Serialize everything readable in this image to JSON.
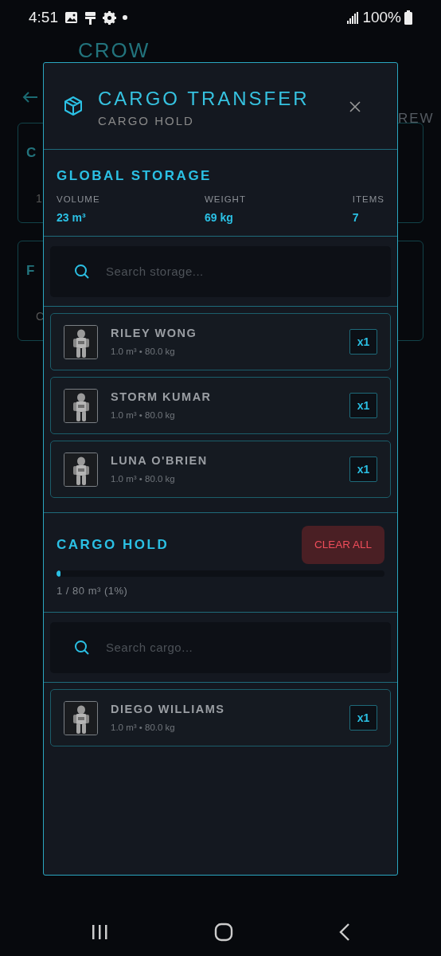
{
  "status_bar": {
    "time": "4:51",
    "battery": "100%"
  },
  "background": {
    "title": "CROW",
    "tab": "REW",
    "cards": [
      {
        "title": "C",
        "line": "1"
      },
      {
        "title": "F",
        "line": "C"
      }
    ]
  },
  "modal": {
    "title": "CARGO TRANSFER",
    "subtitle": "CARGO HOLD",
    "storage": {
      "heading": "GLOBAL STORAGE",
      "stats": [
        {
          "label": "VOLUME",
          "value": "23 m³"
        },
        {
          "label": "WEIGHT",
          "value": "69 kg"
        },
        {
          "label": "ITEMS",
          "value": "7"
        }
      ],
      "search": {
        "placeholder": "Search storage..."
      },
      "items": [
        {
          "name": "RILEY WONG",
          "detail": "1.0 m³ • 80.0 kg",
          "qty": "x1"
        },
        {
          "name": "STORM KUMAR",
          "detail": "1.0 m³ • 80.0 kg",
          "qty": "x1"
        },
        {
          "name": "LUNA O'BRIEN",
          "detail": "1.0 m³ • 80.0 kg",
          "qty": "x1"
        }
      ]
    },
    "cargo": {
      "heading": "CARGO HOLD",
      "clear_button": "CLEAR ALL",
      "level": 0.0125,
      "reading": "1 / 80 m³ (1%)",
      "search": {
        "placeholder": "Search cargo..."
      },
      "items": [
        {
          "name": "DIEGO WILLIAMS",
          "detail": "1.0 m³ • 80.0 kg",
          "qty": "x1"
        }
      ]
    }
  }
}
